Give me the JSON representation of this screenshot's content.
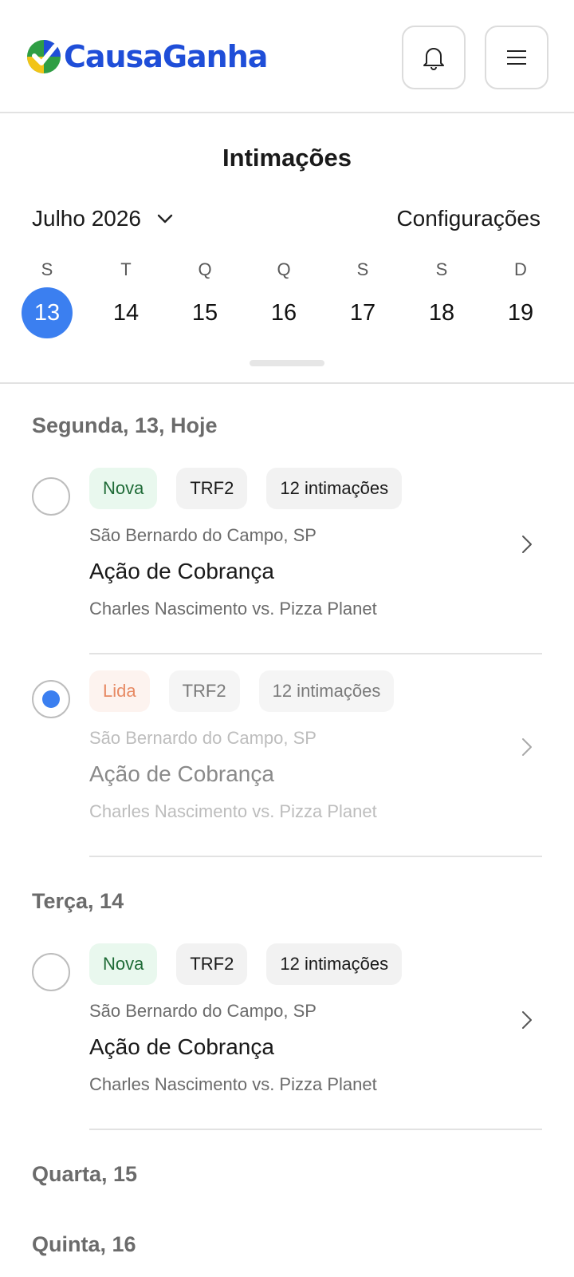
{
  "brand": {
    "name": "CausaGanha"
  },
  "header": {
    "notifications_icon": "bell-icon",
    "menu_icon": "hamburger-menu-icon"
  },
  "page": {
    "title": "Intimações"
  },
  "calendar": {
    "month_label": "Julho 2026",
    "settings_label": "Configurações",
    "days": [
      {
        "weekday": "S",
        "day": "13",
        "selected": true
      },
      {
        "weekday": "T",
        "day": "14",
        "selected": false
      },
      {
        "weekday": "Q",
        "day": "15",
        "selected": false
      },
      {
        "weekday": "Q",
        "day": "16",
        "selected": false
      },
      {
        "weekday": "S",
        "day": "17",
        "selected": false
      },
      {
        "weekday": "S",
        "day": "18",
        "selected": false
      },
      {
        "weekday": "D",
        "day": "19",
        "selected": false
      }
    ]
  },
  "sections": [
    {
      "heading": "Segunda, 13, Hoje",
      "items": [
        {
          "status": "Nova",
          "court": "TRF2",
          "count": "12 intimações",
          "location": "São Bernardo do Campo, SP",
          "title": "Ação de Cobrança",
          "parties": "Charles Nascimento vs. Pizza Planet",
          "read": false
        },
        {
          "status": "Lida",
          "court": "TRF2",
          "count": "12 intimações",
          "location": "São Bernardo do Campo, SP",
          "title": "Ação de Cobrança",
          "parties": "Charles Nascimento vs. Pizza Planet",
          "read": true
        }
      ]
    },
    {
      "heading": "Terça, 14",
      "items": [
        {
          "status": "Nova",
          "court": "TRF2",
          "count": "12 intimações",
          "location": "São Bernardo do Campo, SP",
          "title": "Ação de Cobrança",
          "parties": "Charles Nascimento vs. Pizza Planet",
          "read": false
        }
      ]
    },
    {
      "heading": "Quarta, 15",
      "items": []
    },
    {
      "heading": "Quinta, 16",
      "items": []
    }
  ],
  "colors": {
    "accent": "#3b7ff0",
    "brand_text": "#1f4ed8",
    "nova_bg": "#e9f8ee",
    "nova_text": "#1f6b37",
    "lida_bg": "#fdf3ef",
    "lida_text": "#e78a64"
  }
}
